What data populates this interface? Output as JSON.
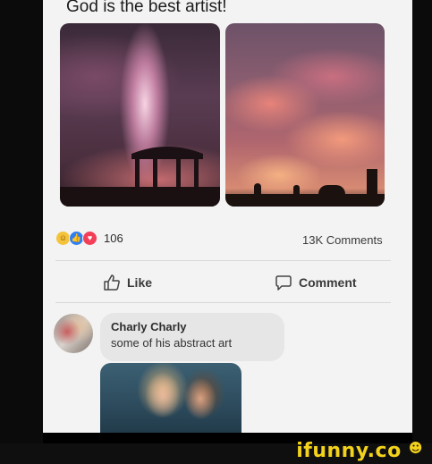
{
  "post": {
    "caption": "God is the best artist!",
    "reactions": {
      "icons": [
        "haha-icon",
        "like-icon",
        "love-icon"
      ],
      "count": "106"
    },
    "comments_count": "13K Comments",
    "actions": {
      "like_label": "Like",
      "comment_label": "Comment"
    }
  },
  "comment": {
    "author": "Charly Charly",
    "text": "some of his abstract art"
  },
  "watermark": {
    "brand": "ifunny.co"
  },
  "colors": {
    "post_bg": "#f3f3f3",
    "bubble_bg": "#e6e6e6",
    "brand_yellow": "#f3d21b",
    "like_blue": "#2d7ff5",
    "love_red": "#f33e58",
    "haha_yellow": "#f5c33b"
  }
}
